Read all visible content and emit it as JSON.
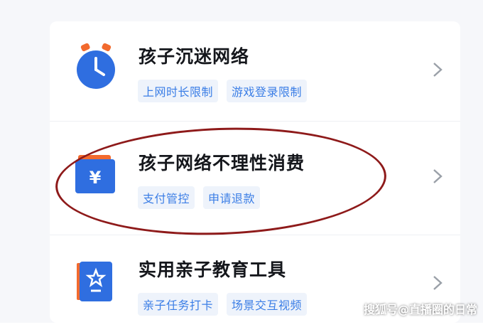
{
  "items": [
    {
      "title": "孩子沉迷网络",
      "tags": [
        "上网时长限制",
        "游戏登录限制"
      ],
      "icon": "alarm-clock-icon"
    },
    {
      "title": "孩子网络不理性消费",
      "tags": [
        "支付管控",
        "申请退款"
      ],
      "icon": "wallet-yen-icon"
    },
    {
      "title": "实用亲子教育工具",
      "tags": [
        "亲子任务打卡",
        "场景交互视频"
      ],
      "icon": "star-book-icon"
    }
  ],
  "watermark": "搜狐号@直播圈的日常",
  "colors": {
    "accent": "#3b7ee6",
    "tag_bg": "#eef3fb",
    "icon_orange": "#f26a2e",
    "annotation": "#8e1a1a"
  }
}
